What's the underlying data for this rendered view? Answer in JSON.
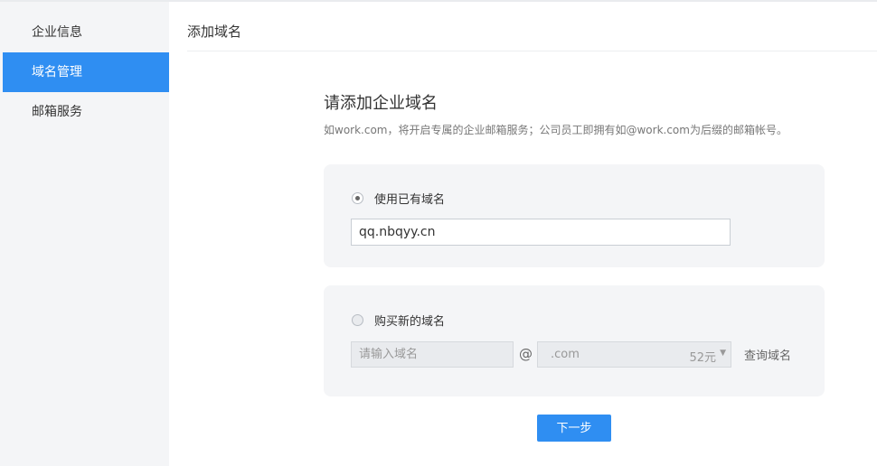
{
  "sidebar": {
    "items": [
      {
        "label": "企业信息",
        "active": false
      },
      {
        "label": "域名管理",
        "active": true
      },
      {
        "label": "邮箱服务",
        "active": false
      }
    ]
  },
  "main": {
    "title": "添加域名",
    "heading": "请添加企业域名",
    "description": "如work.com，将开启专属的企业邮箱服务；公司员工即拥有如@work.com为后缀的邮箱帐号。",
    "existing_domain": {
      "label": "使用已有域名",
      "selected": true,
      "value": "qq.nbqyy.cn"
    },
    "new_domain": {
      "label": "购买新的域名",
      "selected": false,
      "placeholder": "请输入域名",
      "at": "@",
      "suffix": ".com",
      "price": "52元",
      "query_label": "查询域名"
    },
    "next_button": "下一步"
  },
  "colors": {
    "accent": "#2f8ef2",
    "sidebar_bg": "#f4f5f7",
    "card_bg": "#f4f5f7"
  }
}
